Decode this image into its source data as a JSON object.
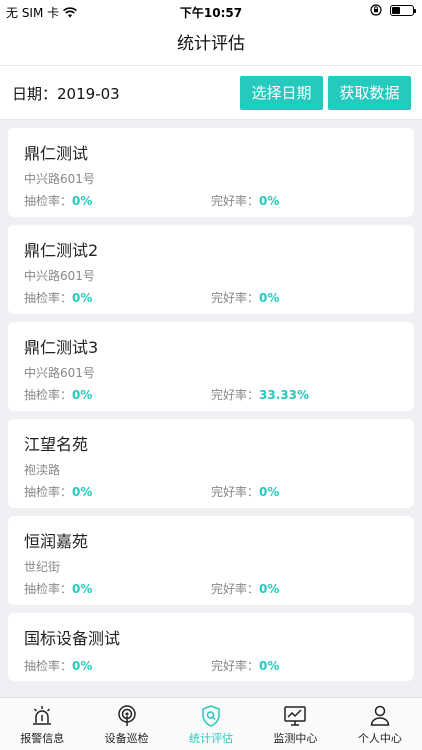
{
  "status_bar": {
    "carrier": "无 SIM 卡",
    "time": "下午10:57"
  },
  "nav": {
    "title": "统计评估"
  },
  "date_bar": {
    "label": "日期：",
    "value": "2019-03",
    "select_button": "选择日期",
    "fetch_button": "获取数据"
  },
  "items": [
    {
      "name": "鼎仁测试",
      "address": "中兴路601号",
      "check_label": "抽检率：",
      "check_rate": "0%",
      "good_label": "完好率：",
      "good_rate": "0%"
    },
    {
      "name": "鼎仁测试2",
      "address": "中兴路601号",
      "check_label": "抽检率：",
      "check_rate": "0%",
      "good_label": "完好率：",
      "good_rate": "0%"
    },
    {
      "name": "鼎仁测试3",
      "address": "中兴路601号",
      "check_label": "抽检率：",
      "check_rate": "0%",
      "good_label": "完好率：",
      "good_rate": "33.33%"
    },
    {
      "name": "江望名苑",
      "address": "袍渎路",
      "check_label": "抽检率：",
      "check_rate": "0%",
      "good_label": "完好率：",
      "good_rate": "0%"
    },
    {
      "name": "恒润嘉苑",
      "address": "世纪街",
      "check_label": "抽检率：",
      "check_rate": "0%",
      "good_label": "完好率：",
      "good_rate": "0%"
    },
    {
      "name": "国标设备测试",
      "address": "",
      "check_label": "抽检率：",
      "check_rate": "0%",
      "good_label": "完好率：",
      "good_rate": "0%"
    }
  ],
  "tabs": [
    {
      "label": "报警信息",
      "icon": "alarm-icon"
    },
    {
      "label": "设备巡检",
      "icon": "inspection-icon"
    },
    {
      "label": "统计评估",
      "icon": "shield-search-icon",
      "active": true
    },
    {
      "label": "监测中心",
      "icon": "monitor-icon"
    },
    {
      "label": "个人中心",
      "icon": "person-icon"
    }
  ],
  "colors": {
    "accent": "#26c9be"
  }
}
